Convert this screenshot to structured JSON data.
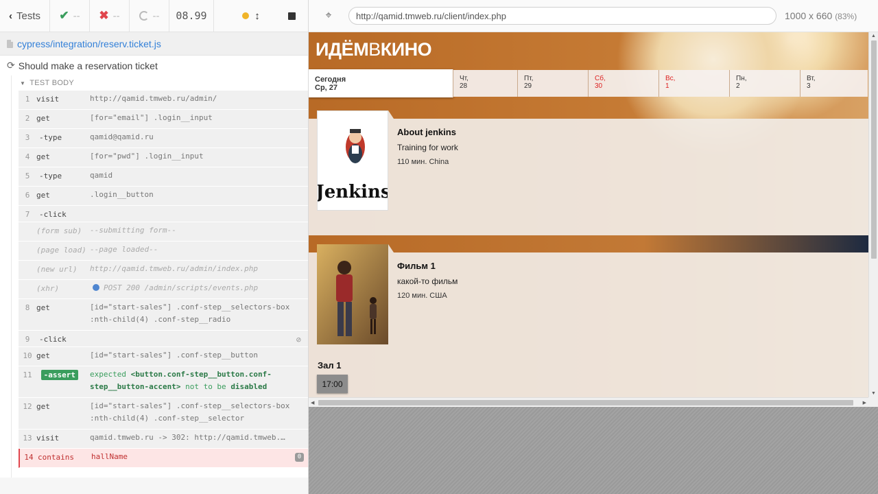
{
  "reporter": {
    "header": {
      "back_label": "Tests",
      "passed": "--",
      "failed": "--",
      "pending": "--",
      "duration": "08.99"
    },
    "spec_path": "cypress/integration/reserv.ticket.js",
    "test_title": "Should make a reservation ticket",
    "section_label": "TEST BODY",
    "commands": [
      {
        "num": "1",
        "name": "visit",
        "msg": "http://qamid.tmweb.ru/admin/"
      },
      {
        "num": "2",
        "name": "get",
        "msg": "[for=\"email\"] .login__input"
      },
      {
        "num": "3",
        "name": "-type",
        "msg": "qamid@qamid.ru"
      },
      {
        "num": "4",
        "name": "get",
        "msg": "[for=\"pwd\"] .login__input"
      },
      {
        "num": "5",
        "name": "-type",
        "msg": "qamid"
      },
      {
        "num": "6",
        "name": "get",
        "msg": ".login__button"
      },
      {
        "num": "7",
        "name": "-click",
        "msg": ""
      },
      {
        "num": "",
        "name": "(form sub)",
        "msg": "--submitting form--"
      },
      {
        "num": "",
        "name": "(page load)",
        "msg": "--page loaded--"
      },
      {
        "num": "",
        "name": "(new url)",
        "msg": "http://qamid.tmweb.ru/admin/index.php"
      },
      {
        "num": "",
        "name": "(xhr)",
        "msg": "POST 200 /admin/scripts/events.php"
      },
      {
        "num": "8",
        "name": "get",
        "msg": "[id=\"start-sales\"] .conf-step__selectors-box :nth-child(4) .conf-step__radio"
      },
      {
        "num": "9",
        "name": "-click",
        "msg": ""
      },
      {
        "num": "10",
        "name": "get",
        "msg": "[id=\"start-sales\"] .conf-step__button"
      },
      {
        "num": "11",
        "name": "-assert",
        "msg_expected": "expected",
        "msg_el": "<button.conf-step__button.conf-step__button-accent>",
        "msg_not": "not to be",
        "msg_state": "disabled"
      },
      {
        "num": "12",
        "name": "get",
        "msg": "[id=\"start-sales\"] .conf-step__selectors-box :nth-child(4) .conf-step__selector"
      },
      {
        "num": "13",
        "name": "visit",
        "msg": "qamid.tmweb.ru -> 302: http://qamid.tmweb.…"
      },
      {
        "num": "14",
        "name": "contains",
        "msg": "hallName",
        "badge": "0"
      }
    ]
  },
  "aut": {
    "url": "http://qamid.tmweb.ru/client/index.php",
    "viewport": "1000 x 660",
    "scale": "(83%)",
    "site": {
      "title_a": "ИДЁМ",
      "title_b": "В",
      "title_c": "КИНО",
      "days": [
        {
          "dow": "Сегодня",
          "date": "Ср, 27",
          "weekend": false
        },
        {
          "dow": "Чт,",
          "date": "28",
          "weekend": false
        },
        {
          "dow": "Пт,",
          "date": "29",
          "weekend": false
        },
        {
          "dow": "Сб,",
          "date": "30",
          "weekend": true
        },
        {
          "dow": "Вс,",
          "date": "1",
          "weekend": true
        },
        {
          "dow": "Пн,",
          "date": "2",
          "weekend": false
        },
        {
          "dow": "Вт,",
          "date": "3",
          "weekend": false
        }
      ],
      "movies": [
        {
          "title": "About jenkins",
          "desc": "Training for work",
          "meta": "110 мин. China",
          "poster_text": "Jenkins"
        },
        {
          "title": "Фильм 1",
          "desc": "какой-то фильм",
          "meta": "120 мин. США",
          "hall": "Зал 1",
          "seance": "17:00"
        }
      ]
    }
  },
  "colors": {
    "pass": "#3a9d5d",
    "fail": "#e0454d",
    "link": "#3380d8",
    "site_brown": "#b86a26"
  }
}
